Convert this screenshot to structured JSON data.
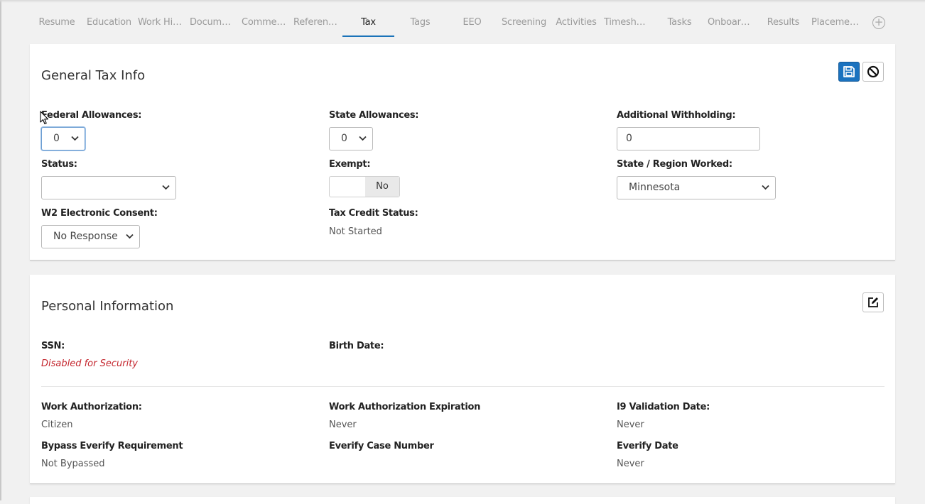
{
  "tabs": [
    {
      "label": "Resume",
      "active": false
    },
    {
      "label": "Education",
      "active": false
    },
    {
      "label": "Work History",
      "active": false
    },
    {
      "label": "Documents",
      "active": false
    },
    {
      "label": "Comments",
      "active": false
    },
    {
      "label": "References",
      "active": false
    },
    {
      "label": "Tax",
      "active": true
    },
    {
      "label": "Tags",
      "active": false
    },
    {
      "label": "EEO",
      "active": false
    },
    {
      "label": "Screening",
      "active": false
    },
    {
      "label": "Activities",
      "active": false
    },
    {
      "label": "Timesheets",
      "active": false
    },
    {
      "label": "Tasks",
      "active": false
    },
    {
      "label": "Onboarding",
      "active": false
    },
    {
      "label": "Results",
      "active": false
    },
    {
      "label": "Placements",
      "active": false
    }
  ],
  "tab_add_icon": "plus-circle-icon",
  "general_tax": {
    "title": "General Tax Info",
    "save_icon": "save-icon",
    "cancel_icon": "cancel-icon",
    "federal_allowances": {
      "label": "Federal Allowances:",
      "value": "0"
    },
    "state_allowances": {
      "label": "State Allowances:",
      "value": "0"
    },
    "additional_withholding": {
      "label": "Additional Withholding:",
      "value": "0"
    },
    "status": {
      "label": "Status:",
      "value": ""
    },
    "exempt": {
      "label": "Exempt:",
      "value": "No"
    },
    "state_region": {
      "label": "State / Region Worked:",
      "value": "Minnesota"
    },
    "w2_consent": {
      "label": "W2 Electronic Consent:",
      "value": "No Response"
    },
    "tax_credit": {
      "label": "Tax Credit Status:",
      "value": "Not Started"
    }
  },
  "personal": {
    "title": "Personal Information",
    "edit_icon": "edit-icon",
    "ssn": {
      "label": "SSN:",
      "value": "Disabled for Security"
    },
    "birth_date": {
      "label": "Birth Date:",
      "value": ""
    },
    "work_auth": {
      "label": "Work Authorization:",
      "value": "Citizen"
    },
    "work_auth_exp": {
      "label": "Work Authorization Expiration",
      "value": "Never"
    },
    "i9_date": {
      "label": "I9 Validation Date:",
      "value": "Never"
    },
    "bypass_everify": {
      "label": "Bypass Everify Requirement",
      "value": "Not Bypassed"
    },
    "everify_case": {
      "label": "Everify Case Number",
      "value": ""
    },
    "everify_date": {
      "label": "Everify Date",
      "value": "Never"
    }
  },
  "colors": {
    "accent": "#1b73b9",
    "danger": "#c4262e"
  }
}
